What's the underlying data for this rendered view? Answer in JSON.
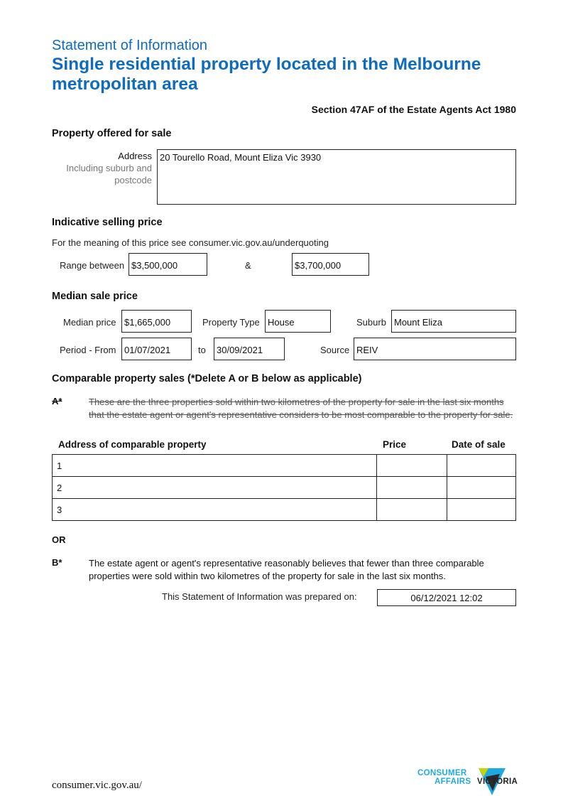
{
  "header": {
    "subtitle": "Statement of Information",
    "title": "Single residential property located in the Melbourne metropolitan area",
    "act_reference": "Section 47AF of the Estate Agents Act 1980"
  },
  "property_offered": {
    "heading": "Property offered for sale",
    "address_label": "Address",
    "address_sublabel": "Including suburb and postcode",
    "address_value": "20 Tourello Road, Mount Eliza Vic 3930"
  },
  "indicative_price": {
    "heading": "Indicative selling price",
    "note": "For the meaning of this price see consumer.vic.gov.au/underquoting",
    "range_label": "Range between",
    "low": "$3,500,000",
    "separator": "&",
    "high": "$3,700,000"
  },
  "median": {
    "heading": "Median sale price",
    "median_price_label": "Median price",
    "median_price": "$1,665,000",
    "property_type_label": "Property Type",
    "property_type": "House",
    "suburb_label": "Suburb",
    "suburb": "Mount Eliza",
    "period_from_label": "Period - From",
    "period_from": "01/07/2021",
    "to_label": "to",
    "period_to": "30/09/2021",
    "source_label": "Source",
    "source": "REIV"
  },
  "comparable": {
    "heading": "Comparable property sales (*Delete A or B below as applicable)",
    "a_marker": "A*",
    "a_text": "These are the three properties sold within two kilometres of the property for sale in the last six months that the estate agent or agent's representative considers to be most comparable to the property for sale.",
    "columns": [
      "Address of comparable property",
      "Price",
      "Date of sale"
    ],
    "rows": [
      {
        "address": "1",
        "price": "",
        "date": ""
      },
      {
        "address": "2",
        "price": "",
        "date": ""
      },
      {
        "address": "3",
        "price": "",
        "date": ""
      }
    ],
    "or_label": "OR",
    "b_marker": "B*",
    "b_text": "The estate agent or agent's representative reasonably believes that fewer than three comparable properties were sold within two kilometres of the property for sale in the last six months."
  },
  "prepared": {
    "label": "This Statement of Information was prepared on:",
    "value": "06/12/2021 12:02"
  },
  "footer": {
    "url": "consumer.vic.gov.au/",
    "logo_line1": "CONSUMER",
    "logo_line2": "AFFAIRS",
    "logo_word": "VICTORIA",
    "logo_color": "#1fa9e1"
  }
}
